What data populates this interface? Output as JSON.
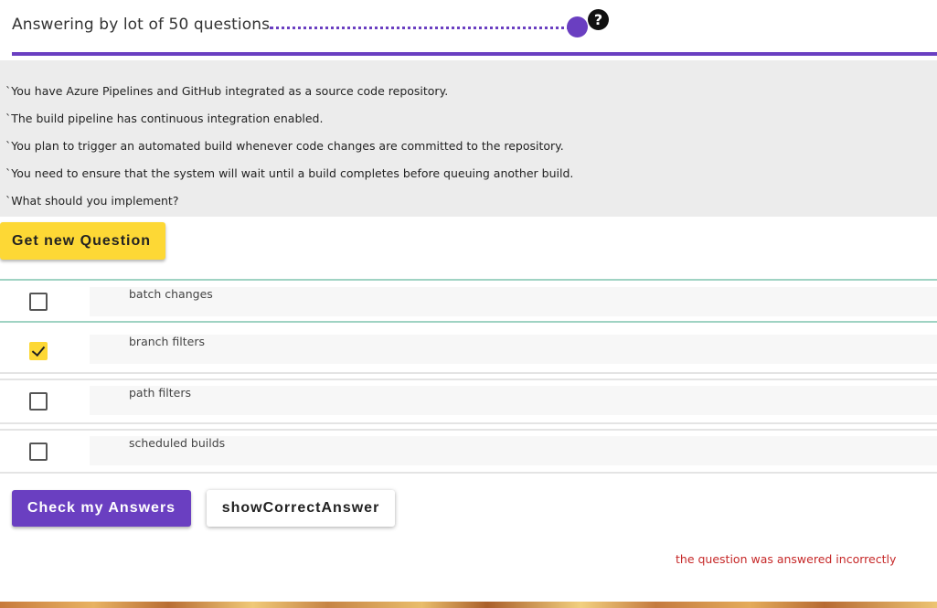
{
  "header": {
    "lot_label": "Answering by lot of 50 questions.",
    "help_glyph": "?",
    "accent_color": "#6a3fc1"
  },
  "question": {
    "lines": [
      "`You have Azure Pipelines and GitHub integrated as a source code repository.",
      "`The build pipeline has continuous integration enabled.",
      "`You plan to trigger an automated build whenever code changes are committed to the repository.",
      "`You need to ensure that the system will wait until a build completes before queuing another build.",
      "`What should you implement?"
    ]
  },
  "buttons": {
    "new_question": "Get new Question",
    "check_answers": "Check my Answers",
    "show_correct": "showCorrectAnswer"
  },
  "answers": [
    {
      "label": "batch changes",
      "checked": false
    },
    {
      "label": "branch filters",
      "checked": true
    },
    {
      "label": "path filters",
      "checked": false
    },
    {
      "label": "scheduled builds",
      "checked": false
    }
  ],
  "result": {
    "message": "the question was answered incorrectly",
    "color": "#c62828"
  },
  "colors": {
    "yellow": "#fdd835",
    "purple": "#6a3fc1",
    "panel_gray": "#ececec"
  }
}
